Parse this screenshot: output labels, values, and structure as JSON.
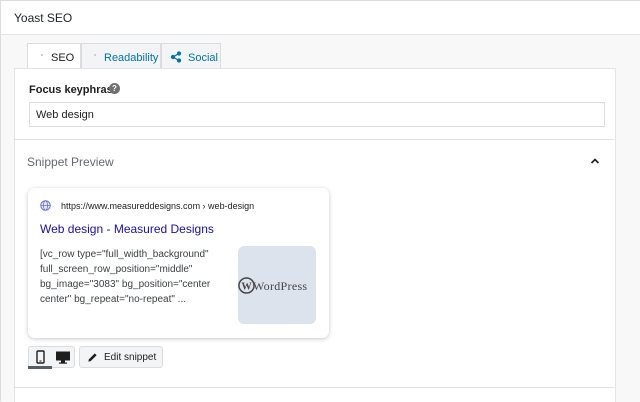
{
  "metabox": {
    "title": "Yoast SEO"
  },
  "tabs": [
    {
      "label": "SEO",
      "active": true
    },
    {
      "label": "Readability",
      "active": false
    },
    {
      "label": "Social",
      "active": false
    }
  ],
  "focus_keyphrase": {
    "label": "Focus keyphrase",
    "help": "?",
    "value": "Web design"
  },
  "snippet_preview": {
    "title": "Snippet Preview",
    "url": "https://www.measureddesigns.com › web-design",
    "page_title": "Web design - Measured Designs",
    "description": "[vc_row type=\"full_width_background\"\nfull_screen_row_position=\"middle\"\nbg_image=\"3083\" bg_position=\"center\ncenter\" bg_repeat=\"no-repeat\" ...",
    "thumbnail_text": "WordPress",
    "preview_mode": "mobile",
    "edit_label": "Edit snippet"
  },
  "colors": {
    "link_blue": "#0073aa",
    "serp_title": "#1a0dab",
    "border": "#e2e4e7"
  }
}
